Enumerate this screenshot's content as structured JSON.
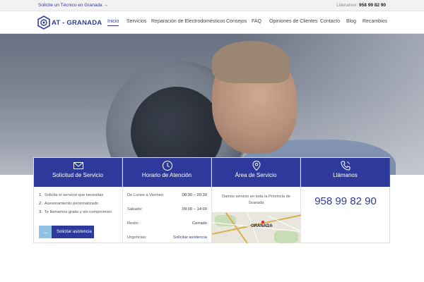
{
  "topbar": {
    "left_link": "Solicite un Técnico en Granada →",
    "call_label": "Llámanos:",
    "call_number": "958 99 82 90"
  },
  "logo": {
    "text": "AT - GRANADA"
  },
  "nav": {
    "items": [
      "Inicio",
      "Servicios",
      "Reparación de Electrodomésticos",
      "Consejos",
      "FAQ",
      "Opiniones de Clientes",
      "Contacto",
      "Blog",
      "Recambios"
    ],
    "active": "Inicio"
  },
  "panels": {
    "request": {
      "title": "Solicitud de Servicio",
      "icon": "envelope-icon",
      "steps": [
        {
          "num": "1.",
          "text": "Solicita el servicio que necesitas"
        },
        {
          "num": "2.",
          "text": "Asesoramiento personalizado"
        },
        {
          "num": "3.",
          "text": "Te llamamos gratis y sin compromiso"
        }
      ],
      "button_label": "Solicitar asistencia"
    },
    "hours": {
      "title": "Horario de Atención",
      "icon": "clock-icon",
      "rows": [
        {
          "day": "De Lunes a Viernes:",
          "time": "08:30 – 20:30"
        },
        {
          "day": "Sábado:",
          "time": "09:00 – 14:00"
        },
        {
          "day": "Resto:",
          "time": "Cerrado"
        },
        {
          "day": "Urgencias:",
          "time": "Solicitar asistencia"
        }
      ]
    },
    "area": {
      "title": "Área de Servicio",
      "icon": "map-pin-icon",
      "text": "Damos servicio en toda la Provincia de Granada",
      "map_city": "GRANADA"
    },
    "call": {
      "title": "Llámanos",
      "icon": "phone-icon",
      "number": "958 99 82 90"
    }
  },
  "colors": {
    "brand": "#2e3a9b",
    "accent_light": "#8fc3e6",
    "topbar_bg": "#f2f2f2"
  }
}
